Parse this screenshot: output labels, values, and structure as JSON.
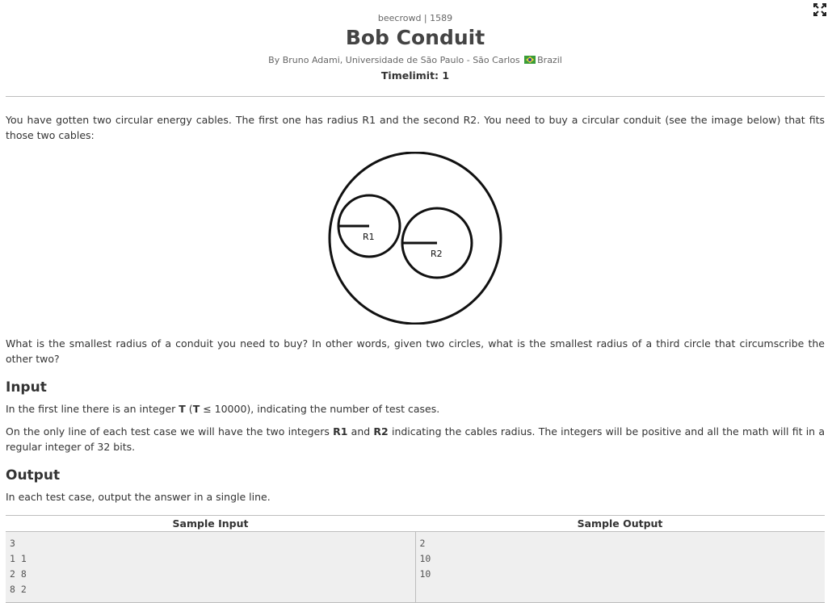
{
  "header": {
    "site_id": "beecrowd | 1589",
    "title": "Bob Conduit",
    "author_prefix": "By Bruno Adami, Universidade de São Paulo - São Carlos",
    "country": "Brazil",
    "timelimit": "Timelimit: 1"
  },
  "description": {
    "paragraph": "You have gotten two circular energy cables. The first one has radius R1 and the second R2. You need to buy a circular conduit (see the image below) that fits those two cables:",
    "figure_labels": {
      "r1": "R1",
      "r2": "R2"
    },
    "question": "What is the smallest radius of a conduit you need to buy? In other words, given two circles, what is the smallest radius of a third circle that circumscribe the other two?"
  },
  "input": {
    "heading": "Input",
    "p1_a": "In the first line there is an integer ",
    "p1_t": "T",
    "p1_b": " (",
    "p1_t2": "T",
    "p1_c": " ≤ 10000), indicating the number of test cases.",
    "p2_a": "On the only line of each test case we will have the two integers ",
    "p2_r1": "R1",
    "p2_and": " and ",
    "p2_r2": "R2",
    "p2_b": " indicating the cables radius. The integers will be positive and all the math will fit in a regular integer of 32 bits."
  },
  "output": {
    "heading": "Output",
    "text": "In each test case, output the answer in a single line."
  },
  "samples": {
    "input_header": "Sample Input",
    "output_header": "Sample Output",
    "input_text": "3\n1 1\n2 8\n8 2",
    "output_text": "2\n10\n10"
  }
}
